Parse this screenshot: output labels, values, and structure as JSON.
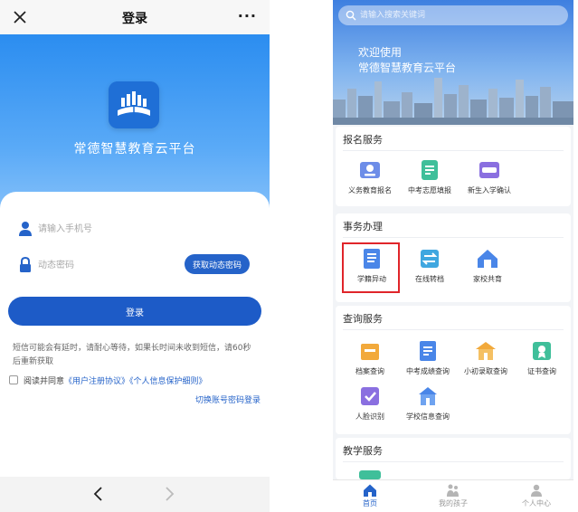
{
  "login": {
    "header": {
      "title": "登录",
      "more_label": "···"
    },
    "brand": "常德智慧教育云平台",
    "phone": {
      "placeholder": "请输入手机号"
    },
    "code": {
      "placeholder": "动态密码",
      "get_code_label": "获取动态密码"
    },
    "login_label": "登录",
    "notice": "短信可能会有延时，请耐心等待，如果长时间未收到短信，请60秒后重新获取",
    "agree": {
      "prefix": "阅读并同意",
      "terms": "《用户注册协议》",
      "privacy": "《个人信息保护细则》"
    },
    "switch_label": "切换账号密码登录"
  },
  "home": {
    "search": {
      "placeholder": "请输入搜索关键词"
    },
    "welcome_line1": "欢迎使用",
    "welcome_line2": "常德智慧教育云平台",
    "sections": {
      "enroll": {
        "title": "报名服务",
        "items": [
          "义务教育报名",
          "中考志愿填报",
          "新生入学确认"
        ]
      },
      "affairs": {
        "title": "事务办理",
        "items": [
          "学籍异动",
          "在线转档",
          "家校共育"
        ]
      },
      "query": {
        "title": "查询服务",
        "items": [
          "档案查询",
          "中考成绩查询",
          "小初录取查询",
          "证书查询",
          "人脸识别",
          "学校信息查询"
        ]
      },
      "teaching": {
        "title": "教学服务"
      }
    },
    "tabs": [
      "首页",
      "我的孩子",
      "个人中心"
    ]
  },
  "colors": {
    "primary": "#1d5bc7",
    "accent": "#2563c9",
    "highlight": "#e0252a"
  }
}
